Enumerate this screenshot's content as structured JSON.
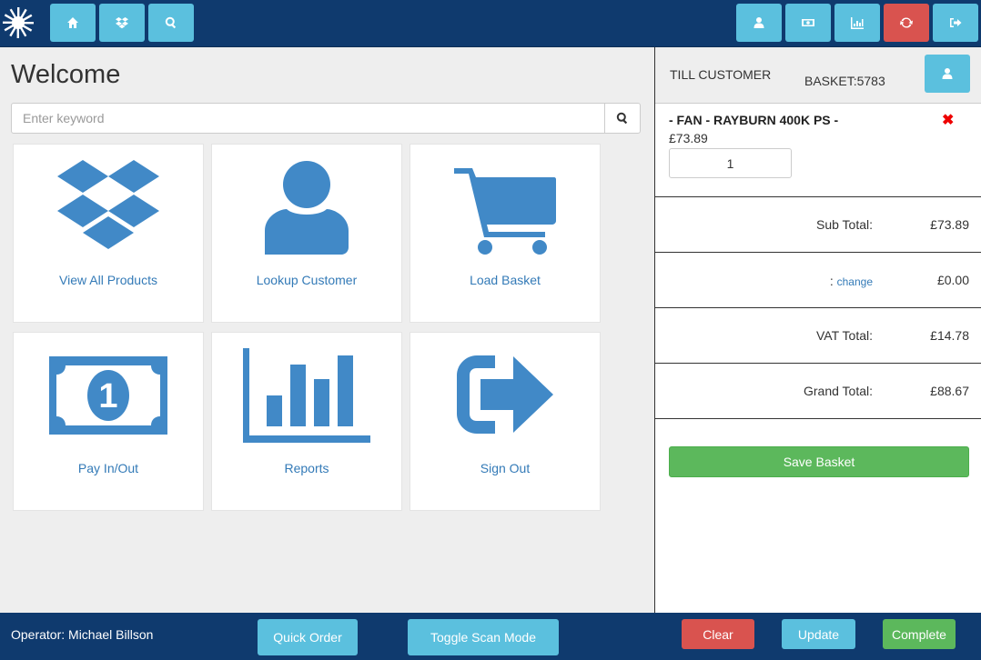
{
  "toolbar": {
    "left_buttons": [
      "home-icon",
      "dropbox-icon",
      "search-icon"
    ],
    "right_buttons": [
      "user-icon",
      "money-icon",
      "chart-icon",
      "refresh-icon",
      "sign-out-icon"
    ]
  },
  "main": {
    "title": "Welcome",
    "search_placeholder": "Enter keyword",
    "tiles": [
      {
        "label": "View All Products",
        "icon": "dropbox-icon"
      },
      {
        "label": "Lookup Customer",
        "icon": "user-icon"
      },
      {
        "label": "Load Basket",
        "icon": "cart-icon"
      },
      {
        "label": "Pay In/Out",
        "icon": "money-icon"
      },
      {
        "label": "Reports",
        "icon": "chart-icon"
      },
      {
        "label": "Sign Out",
        "icon": "sign-out-icon"
      }
    ]
  },
  "basket": {
    "customer": "TILL CUSTOMER",
    "basket_id": "BASKET:5783",
    "item": {
      "name": "- FAN - RAYBURN 400K PS -",
      "price": "£73.89",
      "quantity": "1",
      "remove_symbol": "✖"
    },
    "sub_total_label": "Sub Total:",
    "sub_total": "£73.89",
    "discount_prefix": ":",
    "discount_change": "change",
    "discount_value": "£0.00",
    "vat_label": "VAT Total:",
    "vat_total": "£14.78",
    "grand_label": "Grand Total:",
    "grand_total": "£88.67",
    "save_label": "Save Basket"
  },
  "footer": {
    "operator": "Operator: Michael Billson",
    "quick_order": "Quick Order",
    "toggle_scan": "Toggle Scan Mode",
    "clear": "Clear",
    "update": "Update",
    "complete": "Complete"
  },
  "colors": {
    "header": "#0f3a6e",
    "info": "#5bc0de",
    "danger": "#d9534f",
    "success": "#5cb85c",
    "tile_icon": "#4189c7",
    "link": "#337ab7"
  }
}
